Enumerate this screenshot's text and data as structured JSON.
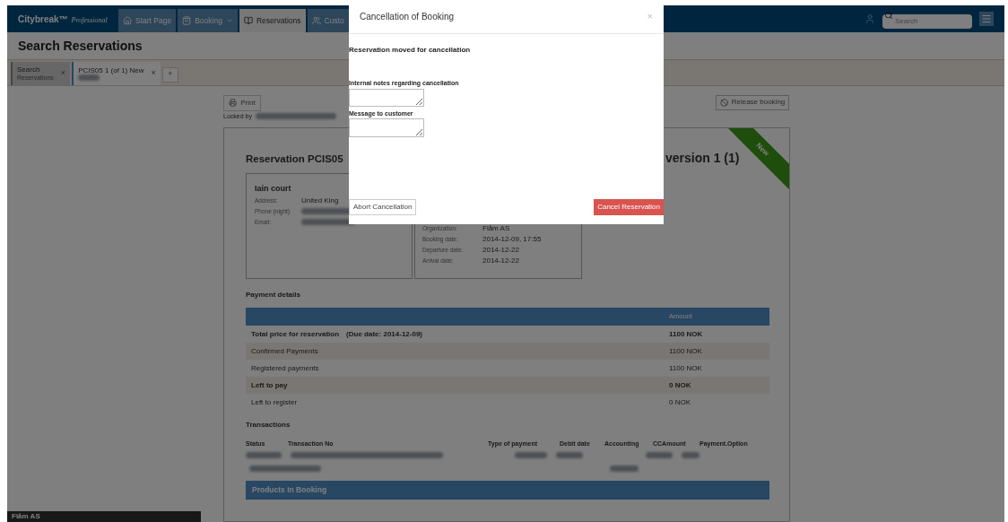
{
  "navbar": {
    "logo": "Citybreak™",
    "logo_sub": "Professional",
    "tabs": [
      {
        "label": "Start Page",
        "selected": false,
        "dropdown": false
      },
      {
        "label": "Booking",
        "selected": false,
        "dropdown": true
      },
      {
        "label": "Reservations",
        "selected": true,
        "dropdown": false
      },
      {
        "label": "Custo",
        "selected": false,
        "dropdown": false
      }
    ],
    "search": {
      "placeholder": "Search"
    }
  },
  "page_title": "Search Reservations",
  "doc_tabs": [
    {
      "title": "Search",
      "subtitle": "Reservations",
      "selected": false,
      "close": "×"
    },
    {
      "title": "PCIS05 1 (of 1) New",
      "selected": true,
      "close": "×"
    }
  ],
  "add_tab": "+",
  "toolbar": {
    "print": "Print",
    "locked_by": "Locked by",
    "release": "Release booking"
  },
  "reservation": {
    "title": "Reservation PCIS05",
    "version": "version 1 (1)",
    "ribbon": "New",
    "customer": {
      "name": "Iain court",
      "fields": [
        {
          "label": "Address:",
          "value": "United King"
        },
        {
          "label": "Phone (night):"
        },
        {
          "label": "Email:"
        }
      ]
    },
    "booking": {
      "fields": [
        {
          "label": "Organization:",
          "value": "Flåm AS"
        },
        {
          "label": "Booking date:",
          "value": "2014-12-09, 17:55"
        },
        {
          "label": "Departure date:",
          "value": "2014-12-22"
        },
        {
          "label": "Arrival date:",
          "value": "2014-12-22"
        }
      ]
    }
  },
  "payment": {
    "title": "Payment details",
    "amount_header": "Amount",
    "rows": [
      {
        "label": "Total price for reservation",
        "note": "(Due date: 2014-12-09)",
        "amount": "1100 NOK",
        "bold": true
      },
      {
        "label": "Confirmed Payments",
        "amount": "1100 NOK",
        "bold": false
      },
      {
        "label": "Registered payments",
        "amount": "1100 NOK",
        "bold": false
      },
      {
        "label": "Left to pay",
        "amount": "0 NOK",
        "bold": true
      },
      {
        "label": "Left to register",
        "amount": "0 NOK",
        "bold": false
      }
    ]
  },
  "transactions": {
    "title": "Transactions",
    "columns": [
      "Status",
      "Transaction No",
      "Type of payment",
      "Debit date",
      "Accounting",
      "CCAmount",
      "Payment.Option"
    ]
  },
  "products_header": "Products In Booking",
  "footer_org": "Flåm AS",
  "modal": {
    "title": "Cancellation of Booking",
    "close": "×",
    "status": "Reservation moved for cancellation",
    "internal_label": "Internal notes regarding cancellation",
    "message_label": "Message to customer",
    "abort": "Abort Cancellation",
    "confirm": "Cancel Reservation"
  }
}
